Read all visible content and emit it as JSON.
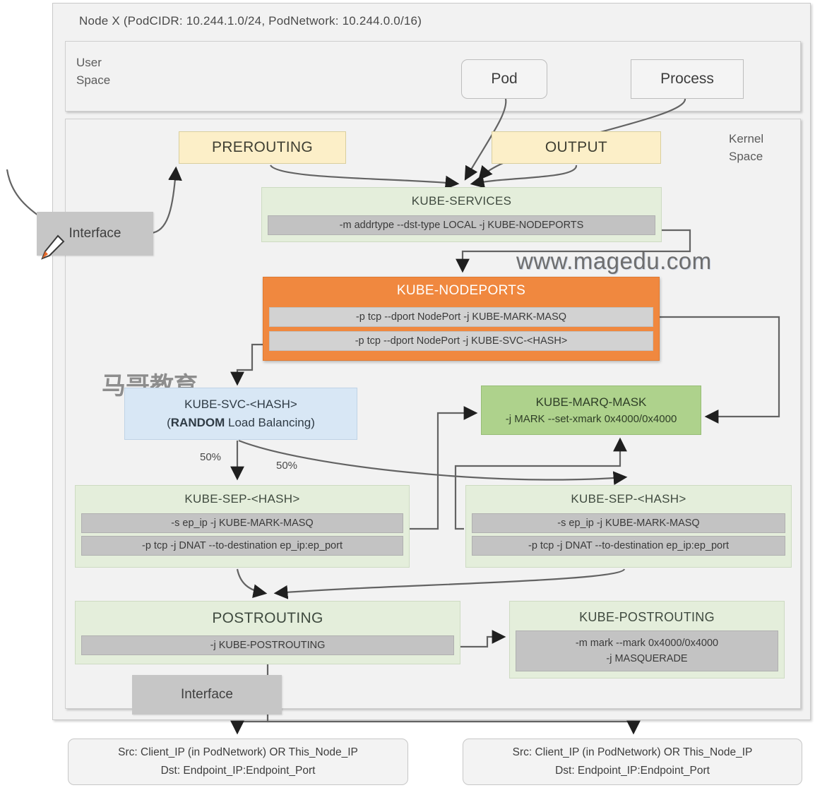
{
  "node": {
    "title": "Node X (PodCIDR: 10.244.1.0/24, PodNetwork: 10.244.0.0/16)",
    "user_space_label": "User\nSpace",
    "user_space_label_line1": "User",
    "user_space_label_line2": "Space",
    "kernel_space_label_line1": "Kernel",
    "kernel_space_label_line2": "Space"
  },
  "user_space": {
    "pod": "Pod",
    "process": "Process"
  },
  "hooks": {
    "prerouting": "PREROUTING",
    "output": "OUTPUT",
    "postrouting": "POSTROUTING"
  },
  "interfaces": {
    "left": "Interface",
    "bottom": "Interface"
  },
  "chains": {
    "kube_services": {
      "title": "KUBE-SERVICES",
      "rules": [
        "-m addrtype --dst-type LOCAL -j KUBE-NODEPORTS"
      ]
    },
    "kube_nodeports": {
      "title": "KUBE-NODEPORTS",
      "rules": [
        "-p tcp --dport NodePort -j KUBE-MARK-MASQ",
        "-p tcp --dport NodePort -j KUBE-SVC-<HASH>"
      ]
    },
    "kube_svc": {
      "title": "KUBE-SVC-<HASH>",
      "subtitle_bold": "RANDOM",
      "subtitle_rest": " Load Balancing)",
      "subtitle_open": "(",
      "subtitle_full": "(RANDOM Load Balancing)"
    },
    "kube_marq_mask": {
      "title": "KUBE-MARQ-MASK",
      "rule": "-j MARK --set-xmark 0x4000/0x4000"
    },
    "kube_sep_left": {
      "title": "KUBE-SEP-<HASH>",
      "rules": [
        "-s ep_ip -j KUBE-MARK-MASQ",
        "-p tcp -j DNAT --to-destination ep_ip:ep_port"
      ]
    },
    "kube_sep_right": {
      "title": "KUBE-SEP-<HASH>",
      "rules": [
        "-s ep_ip -j KUBE-MARK-MASQ",
        "-p tcp -j DNAT --to-destination ep_ip:ep_port"
      ]
    },
    "postrouting": {
      "title": "POSTROUTING",
      "rules": [
        "-j KUBE-POSTROUTING"
      ]
    },
    "kube_postrouting": {
      "title": "KUBE-POSTROUTING",
      "rule_line1": "-m mark --mark 0x4000/0x4000",
      "rule_line2": "-j MASQUERADE"
    }
  },
  "labels": {
    "split_left": "50%",
    "split_right": "50%"
  },
  "packets": {
    "left": {
      "src": "Src: Client_IP (in PodNetwork) OR This_Node_IP",
      "dst": "Dst: Endpoint_IP:Endpoint_Port"
    },
    "right": {
      "src": "Src: Client_IP (in PodNetwork) OR This_Node_IP",
      "dst": "Dst: Endpoint_IP:Endpoint_Port"
    }
  },
  "watermarks": {
    "url": "www.magedu.com",
    "chinese": "马哥教育"
  },
  "colors": {
    "hook_fill": "#fcefc8",
    "chain_fill": "#e4eedb",
    "rule_fill": "#c3c3c3",
    "nodeports_fill": "#f0883f",
    "svc_fill": "#d8e7f5",
    "marq_fill": "#aed28c",
    "frame_fill": "#f2f2f2",
    "interface_fill": "#c6c6c6"
  }
}
